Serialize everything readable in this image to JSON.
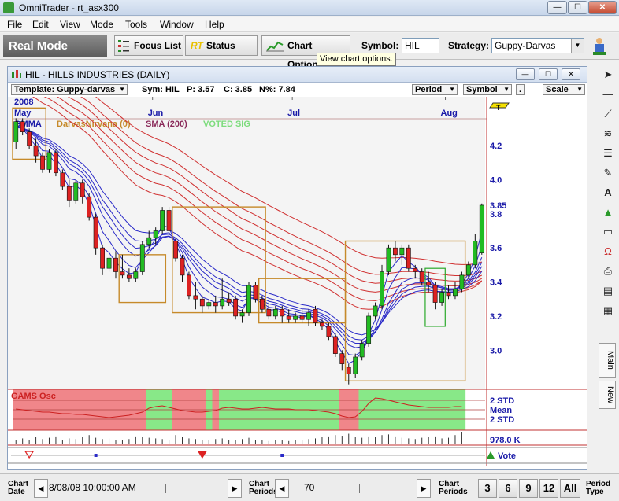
{
  "window": {
    "title": "OmniTrader - rt_asx300",
    "minimize": "—",
    "maximize": "☐",
    "close": "✕"
  },
  "menu": [
    "File",
    "Edit",
    "View",
    "Mode",
    "Tools",
    "Window",
    "Help"
  ],
  "toolbar": {
    "mode": "Real Mode",
    "focus_list": "Focus List",
    "rt_prefix": "RT",
    "status": "Status",
    "chart_options": "Chart Options",
    "symbol_label": "Symbol:",
    "symbol_value": "HIL",
    "strategy_label": "Strategy:",
    "strategy_value": "Guppy-Darvas"
  },
  "tooltip": "View chart options.",
  "chart_window": {
    "title": "HIL - HILLS INDUSTRIES (DAILY)",
    "template": "Template: Guppy-darvas",
    "sym": "Sym: HIL",
    "p": "P: 3.57",
    "c": "C: 3.85",
    "n": "N%: 7.84",
    "period_dd": "Period",
    "symbol_dd": "Symbol",
    "dot_dd": ".",
    "scale_dd": "Scale"
  },
  "chart_data": {
    "type": "candlestick",
    "months": [
      {
        "label": "May",
        "year": "2008",
        "index": 0
      },
      {
        "label": "Jun",
        "index": 21
      },
      {
        "label": "Jul",
        "index": 42
      },
      {
        "label": "Aug",
        "index": 65
      }
    ],
    "legend": [
      {
        "name": "GMMA",
        "color": "#1a1aa8"
      },
      {
        "name": "DarvasNirvana (0)",
        "color": "#c68a2a"
      },
      {
        "name": "SMA (200)",
        "color": "#8a2a5a"
      },
      {
        "name": "VOTED SIG",
        "color": "#7ddc7d"
      }
    ],
    "price_ticks": [
      4.2,
      4.0,
      3.8,
      3.6,
      3.4,
      3.2,
      3.0
    ],
    "ylim": [
      2.78,
      4.44
    ],
    "last_price": 3.85,
    "flag_label": "T",
    "candles": [
      {
        "o": 4.22,
        "h": 4.36,
        "l": 4.18,
        "c": 4.34
      },
      {
        "o": 4.34,
        "h": 4.36,
        "l": 4.26,
        "c": 4.28
      },
      {
        "o": 4.28,
        "h": 4.3,
        "l": 4.18,
        "c": 4.2
      },
      {
        "o": 4.2,
        "h": 4.24,
        "l": 4.1,
        "c": 4.14
      },
      {
        "o": 4.14,
        "h": 4.16,
        "l": 4.04,
        "c": 4.06
      },
      {
        "o": 4.06,
        "h": 4.18,
        "l": 4.04,
        "c": 4.16
      },
      {
        "o": 4.16,
        "h": 4.18,
        "l": 4.02,
        "c": 4.04
      },
      {
        "o": 4.04,
        "h": 4.06,
        "l": 3.94,
        "c": 3.96
      },
      {
        "o": 3.96,
        "h": 4.0,
        "l": 3.84,
        "c": 3.88
      },
      {
        "o": 3.88,
        "h": 4.0,
        "l": 3.86,
        "c": 3.98
      },
      {
        "o": 3.98,
        "h": 4.0,
        "l": 3.86,
        "c": 3.9
      },
      {
        "o": 3.9,
        "h": 3.92,
        "l": 3.76,
        "c": 3.78
      },
      {
        "o": 3.78,
        "h": 3.8,
        "l": 3.56,
        "c": 3.6
      },
      {
        "o": 3.6,
        "h": 3.62,
        "l": 3.44,
        "c": 3.48
      },
      {
        "o": 3.48,
        "h": 3.56,
        "l": 3.46,
        "c": 3.54
      },
      {
        "o": 3.54,
        "h": 3.58,
        "l": 3.42,
        "c": 3.46
      },
      {
        "o": 3.46,
        "h": 3.56,
        "l": 3.42,
        "c": 3.44
      },
      {
        "o": 3.44,
        "h": 3.48,
        "l": 3.4,
        "c": 3.42
      },
      {
        "o": 3.42,
        "h": 3.48,
        "l": 3.4,
        "c": 3.46
      },
      {
        "o": 3.46,
        "h": 3.64,
        "l": 3.44,
        "c": 3.62
      },
      {
        "o": 3.62,
        "h": 3.7,
        "l": 3.6,
        "c": 3.66
      },
      {
        "o": 3.66,
        "h": 3.72,
        "l": 3.62,
        "c": 3.7
      },
      {
        "o": 3.7,
        "h": 3.84,
        "l": 3.68,
        "c": 3.82
      },
      {
        "o": 3.82,
        "h": 3.84,
        "l": 3.68,
        "c": 3.7
      },
      {
        "o": 3.64,
        "h": 3.66,
        "l": 3.52,
        "c": 3.54
      },
      {
        "o": 3.54,
        "h": 3.56,
        "l": 3.4,
        "c": 3.44
      },
      {
        "o": 3.44,
        "h": 3.46,
        "l": 3.3,
        "c": 3.32
      },
      {
        "o": 3.32,
        "h": 3.4,
        "l": 3.24,
        "c": 3.3
      },
      {
        "o": 3.3,
        "h": 3.32,
        "l": 3.22,
        "c": 3.26
      },
      {
        "o": 3.26,
        "h": 3.3,
        "l": 3.24,
        "c": 3.28
      },
      {
        "o": 3.28,
        "h": 3.32,
        "l": 3.22,
        "c": 3.26
      },
      {
        "o": 3.26,
        "h": 3.42,
        "l": 3.24,
        "c": 3.3
      },
      {
        "o": 3.3,
        "h": 3.34,
        "l": 3.26,
        "c": 3.28
      },
      {
        "o": 3.3,
        "h": 3.32,
        "l": 3.18,
        "c": 3.2
      },
      {
        "o": 3.2,
        "h": 3.24,
        "l": 3.16,
        "c": 3.22
      },
      {
        "o": 3.22,
        "h": 3.4,
        "l": 3.2,
        "c": 3.38
      },
      {
        "o": 3.38,
        "h": 3.4,
        "l": 3.28,
        "c": 3.3
      },
      {
        "o": 3.3,
        "h": 3.32,
        "l": 3.22,
        "c": 3.24
      },
      {
        "o": 3.24,
        "h": 3.28,
        "l": 3.18,
        "c": 3.2
      },
      {
        "o": 3.2,
        "h": 3.26,
        "l": 3.18,
        "c": 3.24
      },
      {
        "o": 3.24,
        "h": 3.26,
        "l": 3.16,
        "c": 3.2
      },
      {
        "o": 3.2,
        "h": 3.24,
        "l": 3.16,
        "c": 3.18
      },
      {
        "o": 3.18,
        "h": 3.22,
        "l": 3.16,
        "c": 3.2
      },
      {
        "o": 3.2,
        "h": 3.24,
        "l": 3.16,
        "c": 3.18
      },
      {
        "o": 3.18,
        "h": 3.24,
        "l": 3.14,
        "c": 3.22
      },
      {
        "o": 3.24,
        "h": 3.26,
        "l": 3.14,
        "c": 3.16
      },
      {
        "o": 3.16,
        "h": 3.18,
        "l": 3.12,
        "c": 3.14
      },
      {
        "o": 3.14,
        "h": 3.16,
        "l": 3.06,
        "c": 3.08
      },
      {
        "o": 3.08,
        "h": 3.1,
        "l": 2.96,
        "c": 2.98
      },
      {
        "o": 2.98,
        "h": 3.0,
        "l": 2.88,
        "c": 2.92
      },
      {
        "o": 2.9,
        "h": 2.92,
        "l": 2.8,
        "c": 2.86
      },
      {
        "o": 2.86,
        "h": 2.98,
        "l": 2.84,
        "c": 2.96
      },
      {
        "o": 2.96,
        "h": 3.06,
        "l": 2.94,
        "c": 3.04
      },
      {
        "o": 3.04,
        "h": 3.22,
        "l": 3.02,
        "c": 3.2
      },
      {
        "o": 3.2,
        "h": 3.28,
        "l": 3.18,
        "c": 3.26
      },
      {
        "o": 3.26,
        "h": 3.5,
        "l": 3.24,
        "c": 3.46
      },
      {
        "o": 3.46,
        "h": 3.62,
        "l": 3.44,
        "c": 3.6
      },
      {
        "o": 3.6,
        "h": 3.64,
        "l": 3.52,
        "c": 3.56
      },
      {
        "o": 3.56,
        "h": 3.62,
        "l": 3.5,
        "c": 3.6
      },
      {
        "o": 3.6,
        "h": 3.62,
        "l": 3.46,
        "c": 3.48
      },
      {
        "o": 3.48,
        "h": 3.5,
        "l": 3.42,
        "c": 3.46
      },
      {
        "o": 3.46,
        "h": 3.48,
        "l": 3.38,
        "c": 3.4
      },
      {
        "o": 3.4,
        "h": 3.46,
        "l": 3.34,
        "c": 3.38
      },
      {
        "o": 3.38,
        "h": 3.4,
        "l": 3.24,
        "c": 3.28
      },
      {
        "o": 3.28,
        "h": 3.36,
        "l": 3.26,
        "c": 3.34
      },
      {
        "o": 3.34,
        "h": 3.38,
        "l": 3.3,
        "c": 3.32
      },
      {
        "o": 3.32,
        "h": 3.4,
        "l": 3.3,
        "c": 3.36
      },
      {
        "o": 3.36,
        "h": 3.46,
        "l": 3.34,
        "c": 3.44
      },
      {
        "o": 3.44,
        "h": 3.52,
        "l": 3.42,
        "c": 3.5
      },
      {
        "o": 3.5,
        "h": 3.68,
        "l": 3.48,
        "c": 3.64
      },
      {
        "o": 3.57,
        "h": 3.86,
        "l": 3.56,
        "c": 3.85
      }
    ],
    "darvas_boxes": [
      {
        "start": 0,
        "end": 4,
        "top": 4.42,
        "bottom": 4.12
      },
      {
        "start": 16,
        "end": 22,
        "top": 3.56,
        "bottom": 3.28
      },
      {
        "start": 24,
        "end": 37,
        "top": 3.84,
        "bottom": 3.22
      },
      {
        "start": 37,
        "end": 49,
        "top": 3.42,
        "bottom": 3.16
      },
      {
        "start": 50,
        "end": 67,
        "top": 3.64,
        "bottom": 2.82
      }
    ],
    "voted_box": {
      "start": 62,
      "end": 64,
      "top": 3.48,
      "bottom": 3.14
    },
    "osc": {
      "title": "GAMS Osc",
      "labels": [
        "2 STD",
        "Mean",
        "2 STD"
      ],
      "regimes": [
        "red",
        "red",
        "red",
        "red",
        "red",
        "red",
        "red",
        "red",
        "red",
        "red",
        "red",
        "red",
        "red",
        "red",
        "red",
        "red",
        "red",
        "red",
        "red",
        "red",
        "green",
        "green",
        "green",
        "green",
        "red",
        "red",
        "red",
        "red",
        "red",
        "green",
        "red",
        "green",
        "green",
        "green",
        "green",
        "green",
        "green",
        "green",
        "green",
        "green",
        "green",
        "green",
        "green",
        "green",
        "green",
        "green",
        "green",
        "green",
        "green",
        "red",
        "red",
        "red",
        "green",
        "green",
        "green",
        "green",
        "green",
        "green",
        "green",
        "green",
        "green",
        "green",
        "green",
        "green",
        "green",
        "green",
        "green",
        "green"
      ],
      "values": [
        0.1,
        0.0,
        -0.1,
        -0.2,
        -0.3,
        -0.3,
        -0.4,
        -0.5,
        -0.5,
        -0.6,
        -0.6,
        -0.7,
        -0.8,
        -0.9,
        -1.0,
        -0.9,
        -0.8,
        -0.7,
        -0.5,
        -0.3,
        0.2,
        0.4,
        0.5,
        0.3,
        0.1,
        -0.1,
        -0.2,
        -0.3,
        -0.3,
        -0.2,
        -0.1,
        0.2,
        0.3,
        0.2,
        0.1,
        0.1,
        0.2,
        0.3,
        0.2,
        0.1,
        0.1,
        0.1,
        0.0,
        0.0,
        0.0,
        -0.1,
        -0.2,
        -0.3,
        -0.5,
        -0.8,
        -1.0,
        -0.9,
        -0.2,
        0.8,
        1.5,
        1.4,
        1.2,
        1.0,
        0.8,
        0.6,
        0.5,
        0.4,
        0.3,
        0.3,
        0.3,
        0.3,
        0.4,
        0.4
      ]
    },
    "volume": {
      "label": "978.0 K",
      "values": [
        30,
        45,
        35,
        55,
        40,
        50,
        60,
        35,
        45,
        40,
        55,
        70,
        50,
        40,
        45,
        35,
        30,
        40,
        60,
        55,
        50,
        45,
        40,
        35,
        70,
        55,
        45,
        40,
        35,
        30,
        40,
        45,
        35,
        30,
        40,
        50,
        35,
        30,
        25,
        35,
        30,
        25,
        35,
        30,
        40,
        45,
        55,
        60,
        70,
        65,
        80,
        55,
        50,
        60,
        55,
        70,
        75,
        60,
        50,
        45,
        40,
        50,
        55,
        60,
        45,
        50,
        70,
        95
      ]
    },
    "vote": {
      "label": "Vote",
      "triangles": [
        {
          "index": 2,
          "kind": "short-open"
        },
        {
          "index": 28,
          "kind": "short-filled"
        }
      ],
      "squares": [
        12,
        40
      ]
    }
  },
  "palette": [
    "cursor-arrow-icon",
    "horizontal-line-icon",
    "trendline-icon",
    "fibonacci-icon",
    "chart-list-icon",
    "edit-chart-icon",
    "text-icon",
    "triangle-tool-icon",
    "eraser-icon",
    "magnet-icon",
    "print-icon",
    "format-bars-icon",
    "grid-icon"
  ],
  "side_tabs": {
    "main": "Main",
    "new": "New"
  },
  "bottom": {
    "chart_date_label_1": "Chart",
    "chart_date_label_2": "Date",
    "date_value": "8/08/08 10:00:00 AM",
    "chart_periods_label_1": "Chart",
    "chart_periods_label_2": "Periods",
    "periods_value": "70",
    "chart_periods2_label_1": "Chart",
    "chart_periods2_label_2": "Periods",
    "period_buttons": [
      "3",
      "6",
      "9",
      "12",
      "All"
    ],
    "period_type_label_1": "Period",
    "period_type_label_2": "Type"
  }
}
